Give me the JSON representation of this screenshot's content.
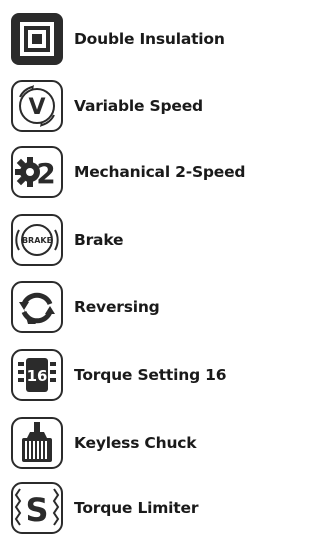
{
  "legend": {
    "items": [
      {
        "icon": "double-insulation-icon",
        "label": "Double Insulation"
      },
      {
        "icon": "variable-speed-icon",
        "label": "Variable Speed",
        "badge": "V"
      },
      {
        "icon": "mechanical-2-speed-icon",
        "label": "Mechanical 2-Speed",
        "badge": "2"
      },
      {
        "icon": "brake-icon",
        "label": "Brake",
        "badge": "BRAKE"
      },
      {
        "icon": "reversing-icon",
        "label": "Reversing"
      },
      {
        "icon": "torque-setting-icon",
        "label": "Torque Setting 16",
        "badge": "16"
      },
      {
        "icon": "keyless-chuck-icon",
        "label": "Keyless Chuck"
      },
      {
        "icon": "torque-limiter-icon",
        "label": "Torque Limiter",
        "badge": "S"
      }
    ]
  }
}
